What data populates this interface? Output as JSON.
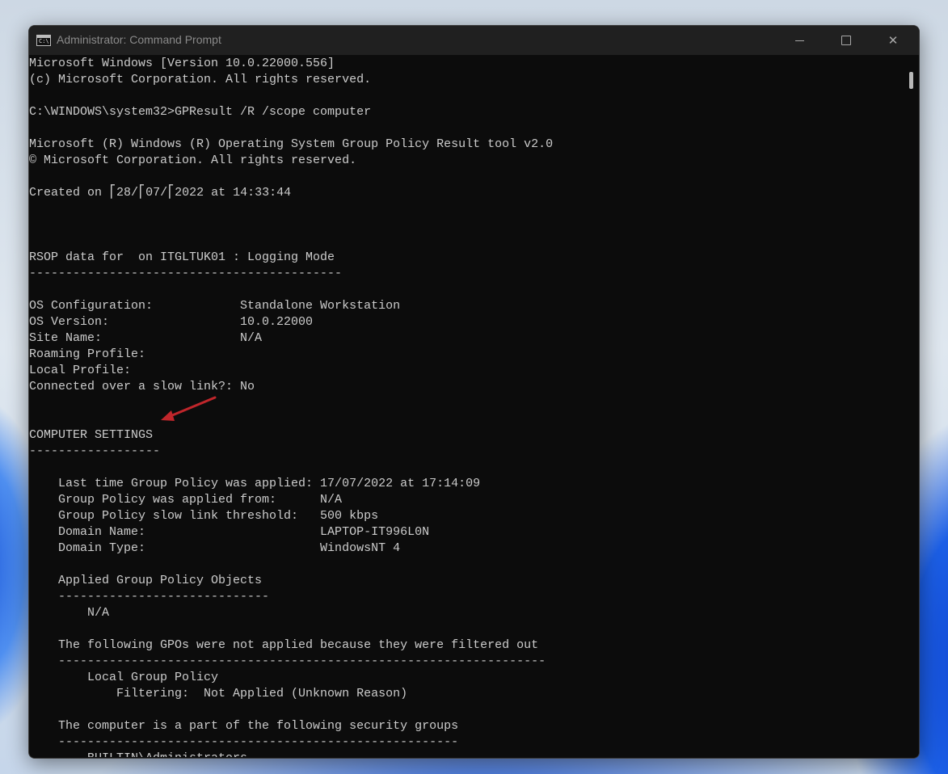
{
  "window": {
    "title": "Administrator: Command Prompt",
    "icon": "cmd-icon",
    "controls": {
      "minimize_icon": "minimize-icon",
      "maximize_icon": "maximize-icon",
      "close_icon": "close-icon",
      "close_glyph": "✕"
    }
  },
  "console": {
    "lines": [
      "Microsoft Windows [Version 10.0.22000.556]",
      "(c) Microsoft Corporation. All rights reserved.",
      "",
      "C:\\WINDOWS\\system32>GPResult /R /scope computer",
      "",
      "Microsoft (R) Windows (R) Operating System Group Policy Result tool v2.0",
      "© Microsoft Corporation. All rights reserved.",
      "",
      "Created on ⎡28/⎡07/⎡2022 at 14:33:44",
      "",
      "",
      "",
      "RSOP data for  on ITGLTUK01 : Logging Mode",
      "-------------------------------------------",
      "",
      "OS Configuration:            Standalone Workstation",
      "OS Version:                  10.0.22000",
      "Site Name:                   N/A",
      "Roaming Profile:",
      "Local Profile:",
      "Connected over a slow link?: No",
      "",
      "",
      "COMPUTER SETTINGS",
      "------------------",
      "",
      "    Last time Group Policy was applied: 17/07/2022 at 17:14:09",
      "    Group Policy was applied from:      N/A",
      "    Group Policy slow link threshold:   500 kbps",
      "    Domain Name:                        LAPTOP-IT996L0N",
      "    Domain Type:                        WindowsNT 4",
      "",
      "    Applied Group Policy Objects",
      "    -----------------------------",
      "        N/A",
      "",
      "    The following GPOs were not applied because they were filtered out",
      "    -------------------------------------------------------------------",
      "        Local Group Policy",
      "            Filtering:  Not Applied (Unknown Reason)",
      "",
      "    The computer is a part of the following security groups",
      "    -------------------------------------------------------",
      "        BUILTIN\\Administrators"
    ]
  },
  "annotation": {
    "arrow_color": "#c0262b"
  },
  "colors": {
    "console_bg": "#0c0c0c",
    "console_text": "#cccccc",
    "titlebar_bg": "#202020"
  }
}
